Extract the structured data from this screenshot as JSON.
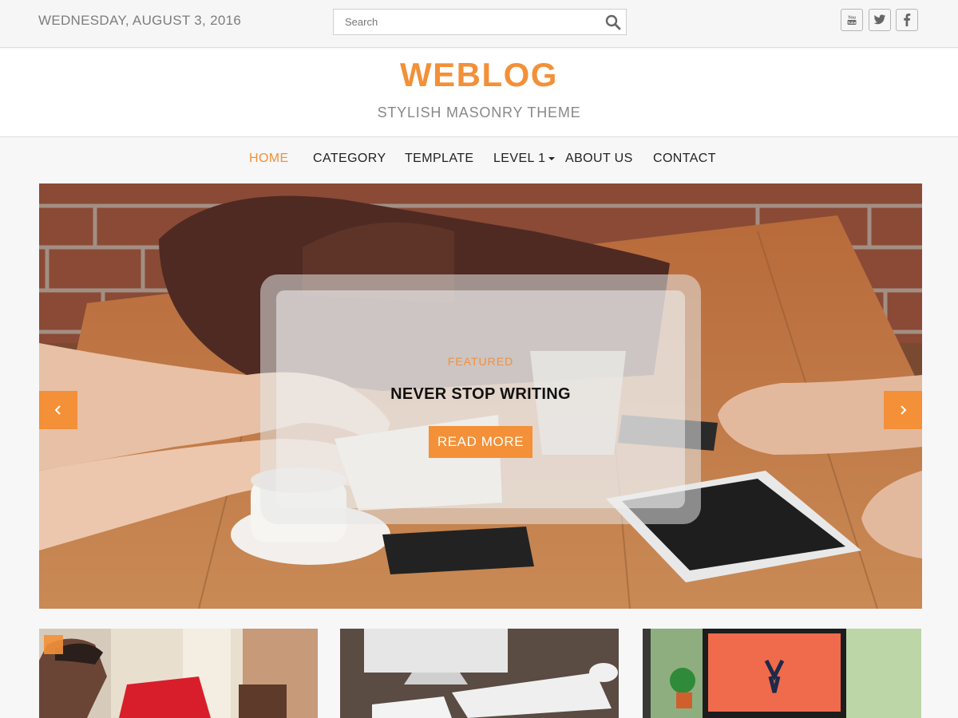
{
  "header": {
    "date": "WEDNESDAY, AUGUST 3, 2016",
    "search_placeholder": "Search",
    "social": [
      {
        "icon": "youtube-icon"
      },
      {
        "icon": "twitter-icon"
      },
      {
        "icon": "facebook-icon"
      }
    ]
  },
  "branding": {
    "title": "WEBLOG",
    "tagline": "STYLISH MASONRY THEME"
  },
  "nav": {
    "items": [
      {
        "label": "HOME",
        "active": true
      },
      {
        "label": "CATEGORY"
      },
      {
        "label": "TEMPLATE"
      },
      {
        "label": "LEVEL 1",
        "has_dropdown": true
      },
      {
        "label": "ABOUT US"
      },
      {
        "label": "CONTACT"
      }
    ]
  },
  "slider": {
    "category": "FEATURED",
    "title": "NEVER STOP WRITING",
    "button": "READ MORE"
  },
  "colors": {
    "accent": "#f39038",
    "muted_text": "#888888"
  }
}
